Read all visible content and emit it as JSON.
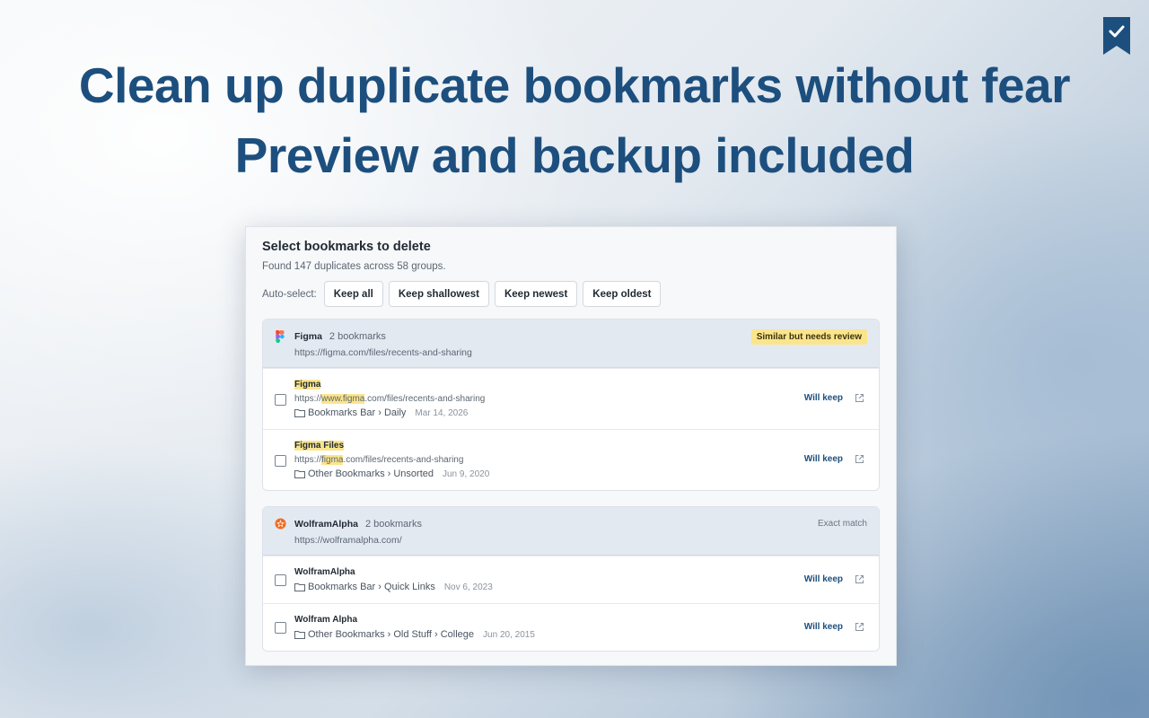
{
  "hero": {
    "line1": "Clean up duplicate bookmarks without fear",
    "line2": "Preview and backup included"
  },
  "panel": {
    "title": "Select bookmarks to delete",
    "subtitle": "Found 147 duplicates across 58 groups.",
    "autoselect_label": "Auto-select:",
    "buttons": [
      "Keep all",
      "Keep shallowest",
      "Keep newest",
      "Keep oldest"
    ]
  },
  "groups": [
    {
      "name": "Figma",
      "count": "2 bookmarks",
      "url": "https://figma.com/files/recents-and-sharing",
      "badge": "Similar but needs review",
      "items": [
        {
          "title": "Figma",
          "url_prefix": "https://",
          "url_highlight": "www.figma",
          "url_suffix": ".com/files/recents-and-sharing",
          "path": "Bookmarks Bar › Daily",
          "date": "Mar 14, 2026",
          "status": "Will keep"
        },
        {
          "title": "Figma Files",
          "url_prefix": "https://",
          "url_highlight": "figma",
          "url_suffix": ".com/files/recents-and-sharing",
          "path": "Other Bookmarks › Unsorted",
          "date": "Jun 9, 2020",
          "status": "Will keep"
        }
      ]
    },
    {
      "name": "WolframAlpha",
      "count": "2 bookmarks",
      "url": "https://wolframalpha.com/",
      "badge": "Exact match",
      "items": [
        {
          "title": "WolframAlpha",
          "path": "Bookmarks Bar › Quick Links",
          "date": "Nov 6, 2023",
          "status": "Will keep"
        },
        {
          "title": "Wolfram Alpha",
          "path": "Other Bookmarks › Old Stuff › College",
          "date": "Jun 20, 2015",
          "status": "Will keep"
        }
      ]
    }
  ],
  "icons": {
    "logo": "bookmark-check-icon",
    "folder": "folder-icon",
    "external": "external-link-icon",
    "figma": "figma-logo-icon",
    "wolfram": "wolframalpha-logo-icon"
  },
  "colors": {
    "brand": "#1d4f7e",
    "highlight": "#fbe58c",
    "group_header": "#e3e9f1"
  }
}
